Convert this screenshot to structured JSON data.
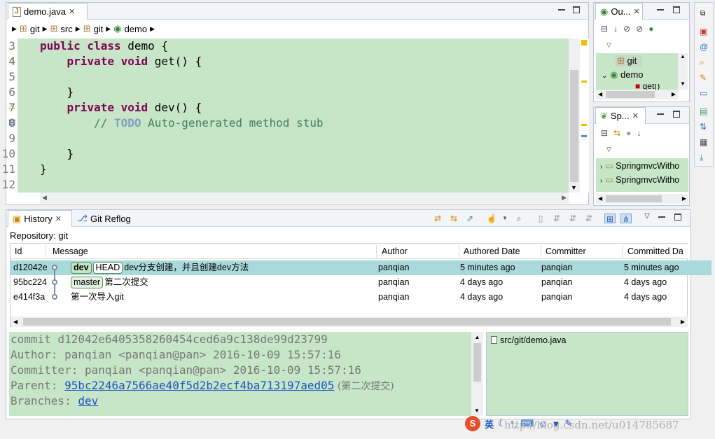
{
  "editor": {
    "tab_label": "demo.java",
    "breadcrumb": [
      "git",
      "src",
      "git",
      "demo"
    ],
    "lines": [
      {
        "num": "3",
        "parts": [
          {
            "t": "public class ",
            "c": "kw"
          },
          {
            "t": "demo {",
            "c": ""
          }
        ]
      },
      {
        "num": "4",
        "parts": [
          {
            "t": "    private void ",
            "c": "kw"
          },
          {
            "t": "get() {",
            "c": ""
          }
        ]
      },
      {
        "num": "5",
        "parts": [
          {
            "t": "",
            "c": ""
          }
        ]
      },
      {
        "num": "6",
        "parts": [
          {
            "t": "    }",
            "c": ""
          }
        ]
      },
      {
        "num": "7",
        "parts": [
          {
            "t": "    private void ",
            "c": "kw"
          },
          {
            "t": "dev() {",
            "c": ""
          }
        ]
      },
      {
        "num": "8",
        "parts": [
          {
            "t": "        // ",
            "c": "cm"
          },
          {
            "t": "TODO",
            "c": "todo"
          },
          {
            "t": " Auto-generated method stub",
            "c": "cm"
          }
        ]
      },
      {
        "num": "9",
        "parts": [
          {
            "t": "",
            "c": ""
          }
        ]
      },
      {
        "num": "10",
        "parts": [
          {
            "t": "    }",
            "c": ""
          }
        ]
      },
      {
        "num": "11",
        "parts": [
          {
            "t": "}",
            "c": ""
          }
        ]
      },
      {
        "num": "12",
        "parts": [
          {
            "t": "",
            "c": ""
          }
        ]
      }
    ]
  },
  "outline": {
    "tab_label": "Ou...",
    "items": [
      "git",
      "demo",
      "get()"
    ]
  },
  "spring": {
    "tab_label": "Sp...",
    "items": [
      "SpringmvcWitho",
      "SpringmvcWitho"
    ]
  },
  "history": {
    "tab_label": "History",
    "reflog_tab_label": "Git Reflog",
    "repository_label": "Repository: git",
    "columns": [
      "Id",
      "Message",
      "Author",
      "Authored Date",
      "Committer",
      "Committed Da"
    ],
    "rows": [
      {
        "id": "d12042e",
        "refs": [
          "dev",
          "HEAD"
        ],
        "message": "dev分支创建，并且创建dev方法",
        "author": "panqian",
        "authored": "5 minutes ago",
        "committer": "panqian",
        "committed": "5 minutes ago"
      },
      {
        "id": "95bc224",
        "refs": [
          "master"
        ],
        "message": "第二次提交",
        "author": "panqian",
        "authored": "4 days ago",
        "committer": "panqian",
        "committed": "4 days ago"
      },
      {
        "id": "e414f3a",
        "refs": [],
        "message": "第一次导入git",
        "author": "panqian",
        "authored": "4 days ago",
        "committer": "panqian",
        "committed": "4 days ago"
      }
    ]
  },
  "commit_detail": {
    "commit": "commit d12042e6405358260454ced6a9c138de99d23799",
    "author": "Author: panqian <panqian@pan> 2016-10-09 15:57:16",
    "committer": "Committer: panqian <panqian@pan> 2016-10-09 15:57:16",
    "parent_label": "Parent: ",
    "parent_hash": "95bc2246a7566ae40f5d2b2ecf4ba713197aed05",
    "parent_note": " (第二次提交)",
    "branches_label": "Branches: ",
    "branch": "dev"
  },
  "files": {
    "items": [
      "src/git/demo.java"
    ]
  },
  "ime": {
    "lang": "英"
  },
  "watermark": "http://blog.csdn.net/u014785687"
}
